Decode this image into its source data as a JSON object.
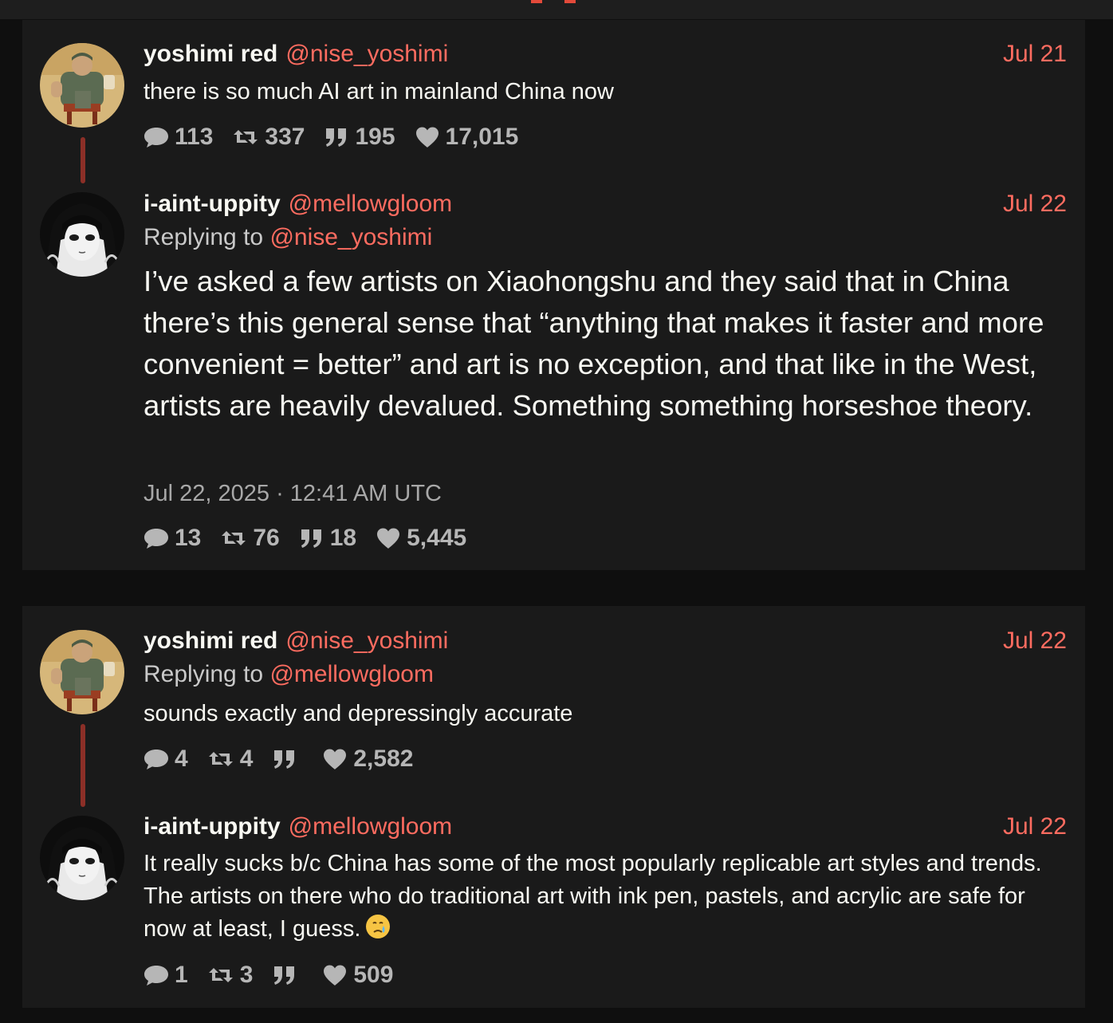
{
  "colors": {
    "accent": "#ff6c60",
    "background": "#0f0f0f",
    "card": "#1a1a1a",
    "thread_line": "#8c2f27"
  },
  "main_thread": {
    "tweets": [
      {
        "fullname": "yoshimi red",
        "username": "@nise_yoshimi",
        "date": "Jul 21",
        "content": "there is so much AI art in mainland China now",
        "stats": {
          "comments": "113",
          "retweets": "337",
          "quotes": "195",
          "likes": "17,015"
        },
        "icons": [
          "comment-icon",
          "retweet-icon",
          "quote-icon",
          "heart-icon"
        ]
      },
      {
        "fullname": "i-aint-uppity",
        "username": "@mellowgloom",
        "date": "Jul 22",
        "replying_label": "Replying to",
        "replying_to": "@nise_yoshimi",
        "content": "I’ve asked a few artists on Xiaohongshu and they said that in China there’s this general sense that “anything that makes it faster and more convenient = better” and art is no exception, and that like in the West, artists are heavily devalued. Something something horseshoe theory.",
        "published": "Jul 22, 2025 · 12:41 AM UTC",
        "stats": {
          "comments": "13",
          "retweets": "76",
          "quotes": "18",
          "likes": "5,445"
        }
      }
    ]
  },
  "reply_thread": {
    "tweets": [
      {
        "fullname": "yoshimi red",
        "username": "@nise_yoshimi",
        "date": "Jul 22",
        "replying_label": "Replying to",
        "replying_to": "@mellowgloom",
        "content": "sounds exactly and depressingly accurate",
        "stats": {
          "comments": "4",
          "retweets": "4",
          "quotes": "",
          "likes": "2,582"
        }
      },
      {
        "fullname": "i-aint-uppity",
        "username": "@mellowgloom",
        "date": "Jul 22",
        "content": "It really sucks b/c China has some of the most popularly replicable art styles and trends. The artists on there who do traditional art with ink pen, pastels, and acrylic are safe for now at least, I guess.",
        "emoji": "crying-face-emoji",
        "stats": {
          "comments": "1",
          "retweets": "3",
          "quotes": "",
          "likes": "509"
        }
      }
    ]
  }
}
